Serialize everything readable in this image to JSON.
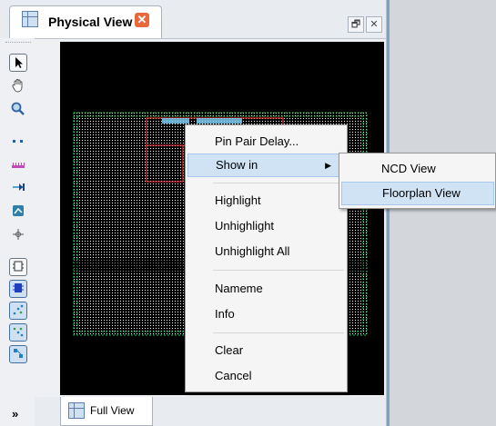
{
  "panel": {
    "tab_title": "Physical View",
    "tab_close_glyph": "✕",
    "restore_glyph": "🗗",
    "close_glyph": "✕"
  },
  "toolbar": {
    "icons": [
      "select-arrow-icon",
      "pan-hand-icon",
      "zoom-magnifier-icon",
      "dots-icon",
      "ruler-icon",
      "arrow-left-icon",
      "route-icon",
      "crosshair-icon",
      "chip-outline-icon",
      "chip-fill-icon",
      "net-scatter-icon",
      "net-scatter-2-icon",
      "net-connect-icon"
    ],
    "more_glyph": "»"
  },
  "context_menu": {
    "items": [
      {
        "label": "Pin Pair Delay...",
        "highlighted": false
      },
      {
        "label": "Show in",
        "highlighted": true,
        "submenu": true
      },
      {
        "label": "Highlight",
        "highlighted": false
      },
      {
        "label": "Unhighlight",
        "highlighted": false
      },
      {
        "label": "Unhighlight All",
        "highlighted": false
      },
      {
        "label": "Nameme",
        "highlighted": false
      },
      {
        "label": "Info",
        "highlighted": false
      },
      {
        "label": "Clear",
        "highlighted": false
      },
      {
        "label": "Cancel",
        "highlighted": false
      }
    ],
    "arrow_glyph": "▶"
  },
  "submenu": {
    "items": [
      {
        "label": "NCD View",
        "highlighted": false
      },
      {
        "label": "Floorplan View",
        "highlighted": true
      }
    ]
  },
  "bottom_tab": {
    "label": "Full View"
  },
  "colors": {
    "canvas": "#000000",
    "grid": "#ffffff",
    "boundary": "#00cc44",
    "highlight_net": "#ff3333",
    "accent": "#cfe3f5"
  }
}
